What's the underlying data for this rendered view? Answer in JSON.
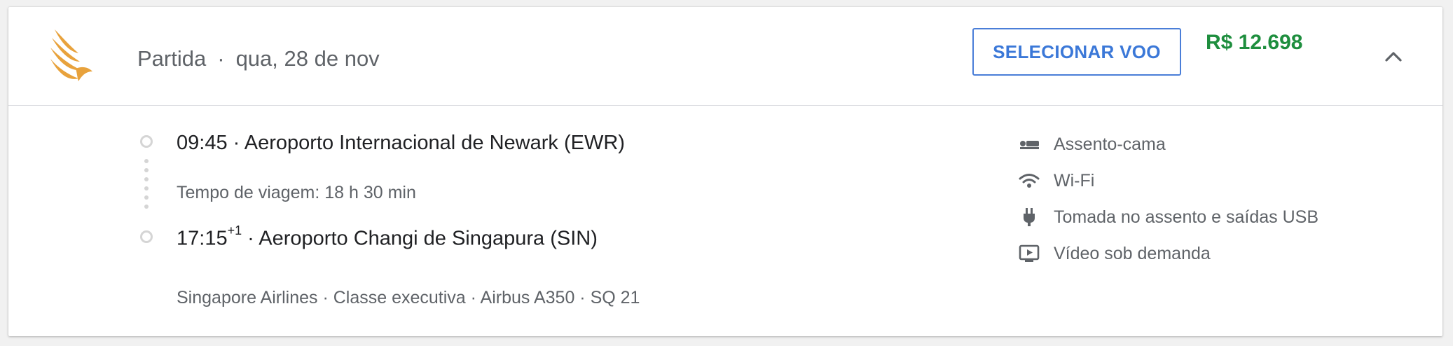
{
  "header": {
    "airline_logo": "singapore-airlines-logo",
    "departure_label": "Partida",
    "separator": "·",
    "departure_date": "qua, 28 de nov",
    "select_button_label": "SELECIONAR VOO",
    "price": "R$ 12.698",
    "collapse_icon": "chevron-up-icon"
  },
  "itinerary": {
    "departure": {
      "time": "09:45",
      "separator": " · ",
      "airport": "Aeroporto Internacional de Newark (EWR)"
    },
    "travel_time": "Tempo de viagem: 18 h 30 min",
    "arrival": {
      "time": "17:15",
      "day_offset": "+1",
      "separator": " · ",
      "airport": "Aeroporto Changi de Singapura (SIN)"
    },
    "details": "Singapore Airlines · Classe executiva · Airbus A350 · SQ 21"
  },
  "amenities": [
    {
      "icon": "lie-flat-seat-icon",
      "label": "Assento-cama"
    },
    {
      "icon": "wifi-icon",
      "label": "Wi-Fi"
    },
    {
      "icon": "power-plug-icon",
      "label": "Tomada no assento e saídas USB"
    },
    {
      "icon": "video-on-demand-icon",
      "label": "Vídeo sob demanda"
    }
  ],
  "colors": {
    "accent_blue": "#3b78d8",
    "price_green": "#1e8e3e",
    "logo_gold": "#e8a23c",
    "text_primary": "#202124",
    "text_secondary": "#5f6368"
  }
}
